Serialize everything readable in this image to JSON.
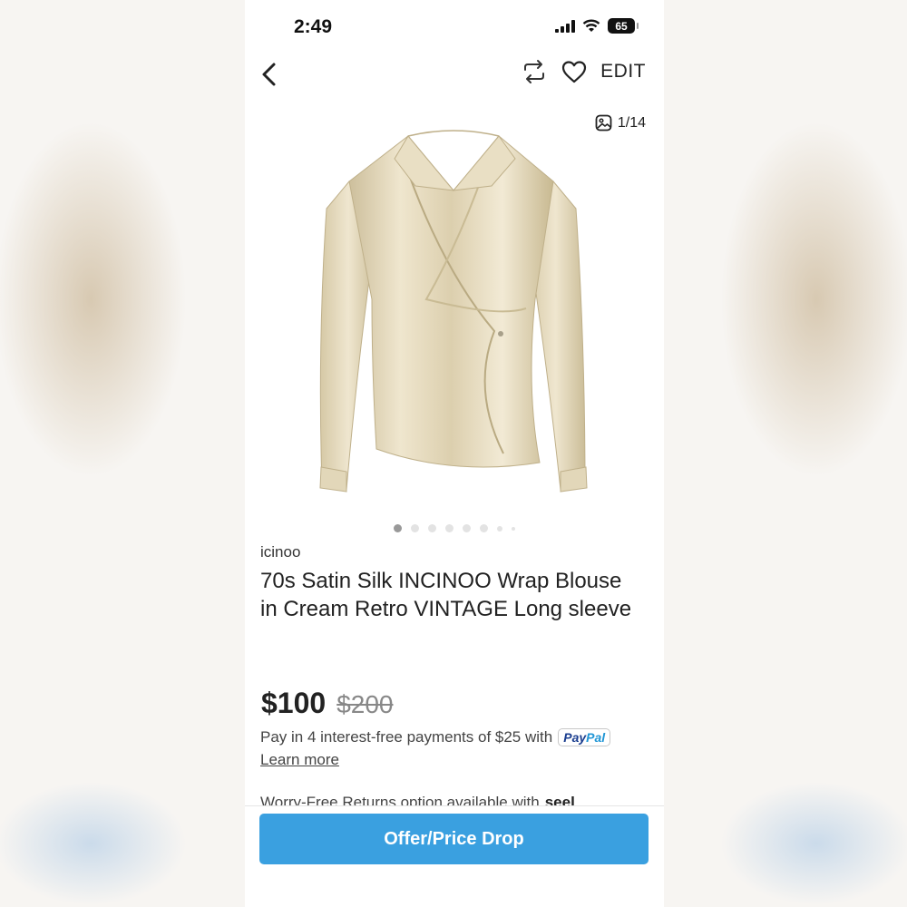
{
  "status_bar": {
    "time": "2:49",
    "battery": "65"
  },
  "nav": {
    "edit_label": "EDIT"
  },
  "photos": {
    "counter": "1/14",
    "dot_count": 8,
    "active_index": 0
  },
  "listing": {
    "brand": "icinoo",
    "title": "70s Satin Silk INCINOO Wrap Blouse in Cream Retro VINTAGE Long sleeve",
    "price": "$100",
    "original_price": "$200"
  },
  "payment": {
    "installments_text": "Pay in 4 interest-free payments of $25 with",
    "paypal_pay": "Pay",
    "paypal_pal": "Pal",
    "learn_more": "Learn more"
  },
  "returns": {
    "text": "Worry-Free Returns option available with",
    "brand": "seel"
  },
  "cta": {
    "label": "Offer/Price Drop"
  },
  "colors": {
    "accent": "#3aa0e0",
    "blouse": "#e8dcbc",
    "paypal_dark": "#1a3d8f",
    "paypal_light": "#2196d6"
  }
}
